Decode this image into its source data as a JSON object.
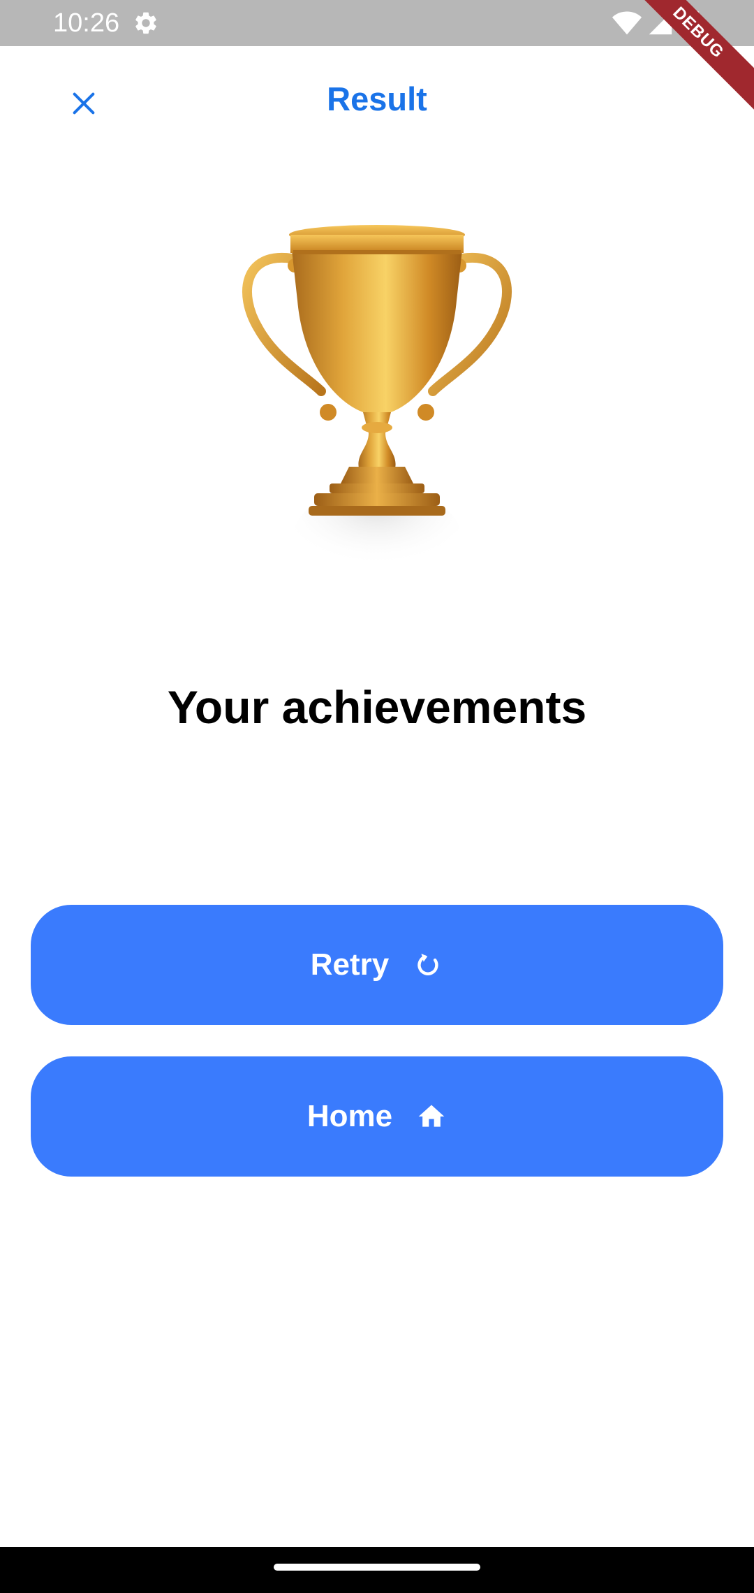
{
  "status_bar": {
    "time": "10:26",
    "icons": [
      "gear-icon",
      "wifi-icon",
      "signal-icon",
      "battery-icon"
    ]
  },
  "debug_banner": {
    "label": "DEBUG",
    "color": "#a0282e"
  },
  "app_bar": {
    "title": "Result",
    "close_icon": "close-icon",
    "accent_color": "#1a73e8"
  },
  "trophy": {
    "icon": "trophy-image"
  },
  "main": {
    "heading": "Your achievements"
  },
  "buttons": {
    "retry": {
      "label": "Retry",
      "icon": "refresh-icon"
    },
    "home": {
      "label": "Home",
      "icon": "home-icon"
    },
    "color": "#3a7bfd"
  },
  "nav_bar": {
    "handle": "gesture-handle"
  }
}
